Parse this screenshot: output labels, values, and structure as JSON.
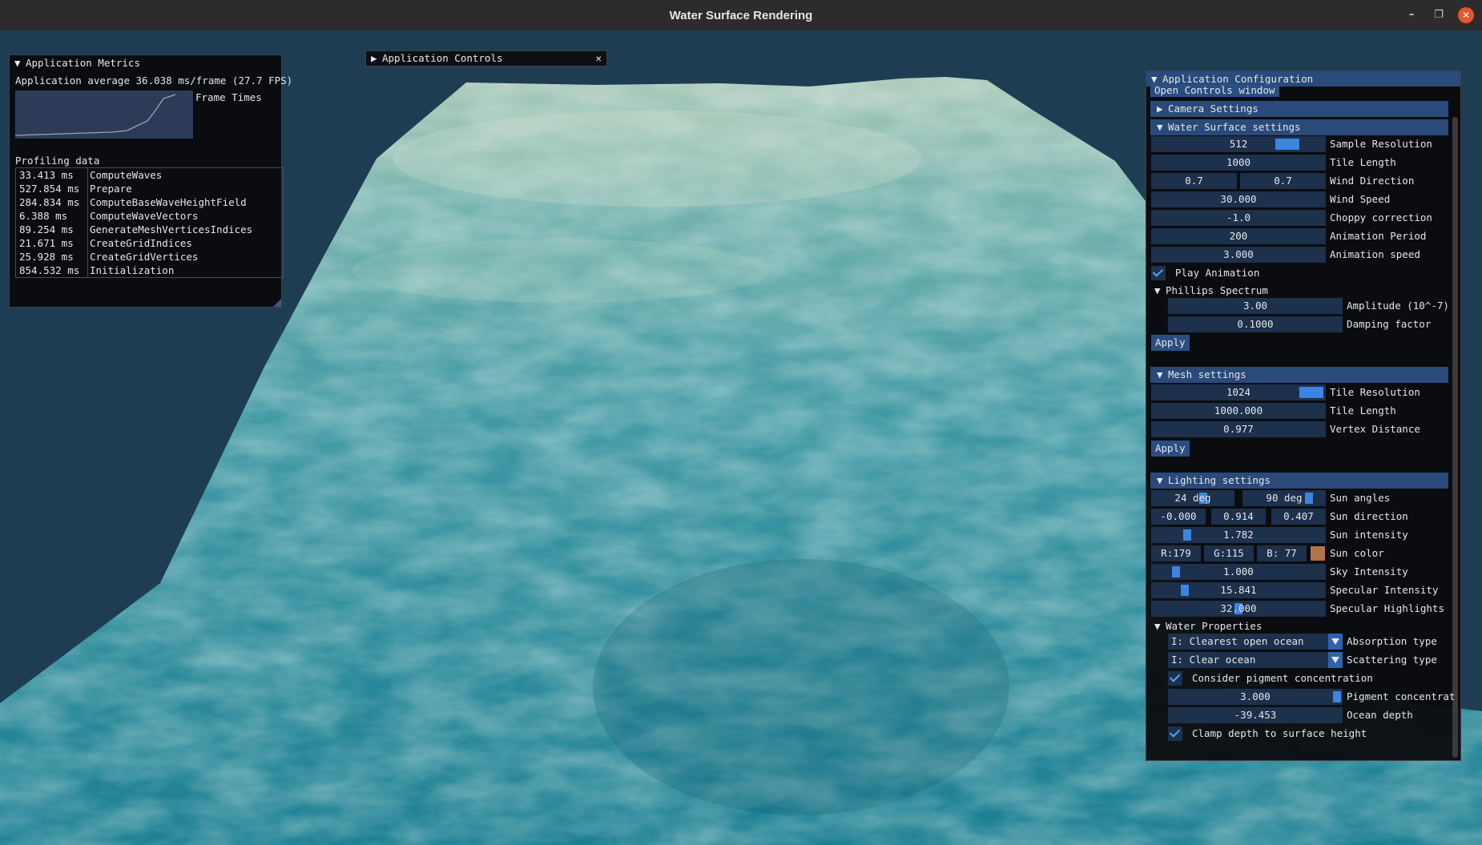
{
  "window": {
    "title": "Water Surface Rendering"
  },
  "metrics": {
    "title": "Application Metrics",
    "average": "Application average 36.038 ms/frame (27.7 FPS)",
    "frame_times_label": "Frame Times",
    "profiling_label": "Profiling data",
    "rows": [
      {
        "time": "33.413 ms",
        "name": "ComputeWaves"
      },
      {
        "time": "527.854 ms",
        "name": "Prepare"
      },
      {
        "time": "284.834 ms",
        "name": "ComputeBaseWaveHeightField"
      },
      {
        "time": "6.388 ms",
        "name": "ComputeWaveVectors"
      },
      {
        "time": "89.254 ms",
        "name": "GenerateMeshVerticesIndices"
      },
      {
        "time": "21.671 ms",
        "name": "CreateGridIndices"
      },
      {
        "time": "25.928 ms",
        "name": "CreateGridVertices"
      },
      {
        "time": "854.532 ms",
        "name": "Initialization"
      }
    ]
  },
  "controls": {
    "title": "Application Controls"
  },
  "config": {
    "title": "Application Configuration",
    "open_controls": "Open Controls window",
    "camera": "Camera Settings",
    "water": {
      "title": "Water Surface settings",
      "sample_resolution": {
        "value": "512",
        "label": "Sample Resolution",
        "fraction": 0.78
      },
      "tile_length": {
        "value": "1000",
        "label": "Tile Length"
      },
      "wind_x": "0.7",
      "wind_y": "0.7",
      "wind_label": "Wind Direction",
      "wind_speed": {
        "value": "30.000",
        "label": "Wind Speed"
      },
      "choppy": {
        "value": "-1.0",
        "label": "Choppy correction"
      },
      "anim_period": {
        "value": "200",
        "label": "Animation Period"
      },
      "anim_speed": {
        "value": "3.000",
        "label": "Animation speed"
      },
      "play": "Play Animation",
      "phillips": "Phillips Spectrum",
      "amplitude": {
        "value": "3.00",
        "label": "Amplitude (10^-7)"
      },
      "damping": {
        "value": "0.1000",
        "label": "Damping factor"
      },
      "apply": "Apply"
    },
    "mesh": {
      "title": "Mesh settings",
      "tile_res": {
        "value": "1024",
        "label": "Tile Resolution",
        "fraction": 0.92
      },
      "tile_len": {
        "value": "1000.000",
        "label": "Tile Length"
      },
      "vertex_dist": {
        "value": "0.977",
        "label": "Vertex Distance"
      },
      "apply": "Apply"
    },
    "lighting": {
      "title": "Lighting settings",
      "sun_a1": "24 deg",
      "sun_a2": "90 deg",
      "sun_angles": "Sun angles",
      "dir_x": "-0.000",
      "dir_y": "0.914",
      "dir_z": "0.407",
      "dir_label": "Sun direction",
      "intensity": {
        "value": "1.782",
        "label": "Sun intensity"
      },
      "r": "R:179",
      "g": "G:115",
      "b": "B: 77",
      "color_label": "Sun color",
      "sun_color": "#b3734d",
      "sky": {
        "value": "1.000",
        "label": "Sky Intensity"
      },
      "spec_int": {
        "value": "15.841",
        "label": "Specular Intensity"
      },
      "spec_hi": {
        "value": "32.000",
        "label": "Specular Highlights"
      }
    },
    "water_props": {
      "title": "Water Properties",
      "absorption": {
        "value": "I: Clearest open ocean",
        "label": "Absorption type"
      },
      "scattering": {
        "value": "I: Clear ocean",
        "label": "Scattering type"
      },
      "pigment_check": "Consider pigment concentration",
      "pigment": {
        "value": "3.000",
        "label": "Pigment concentrat"
      },
      "depth": {
        "value": "-39.453",
        "label": "Ocean depth"
      },
      "clamp": "Clamp depth to surface height"
    }
  }
}
